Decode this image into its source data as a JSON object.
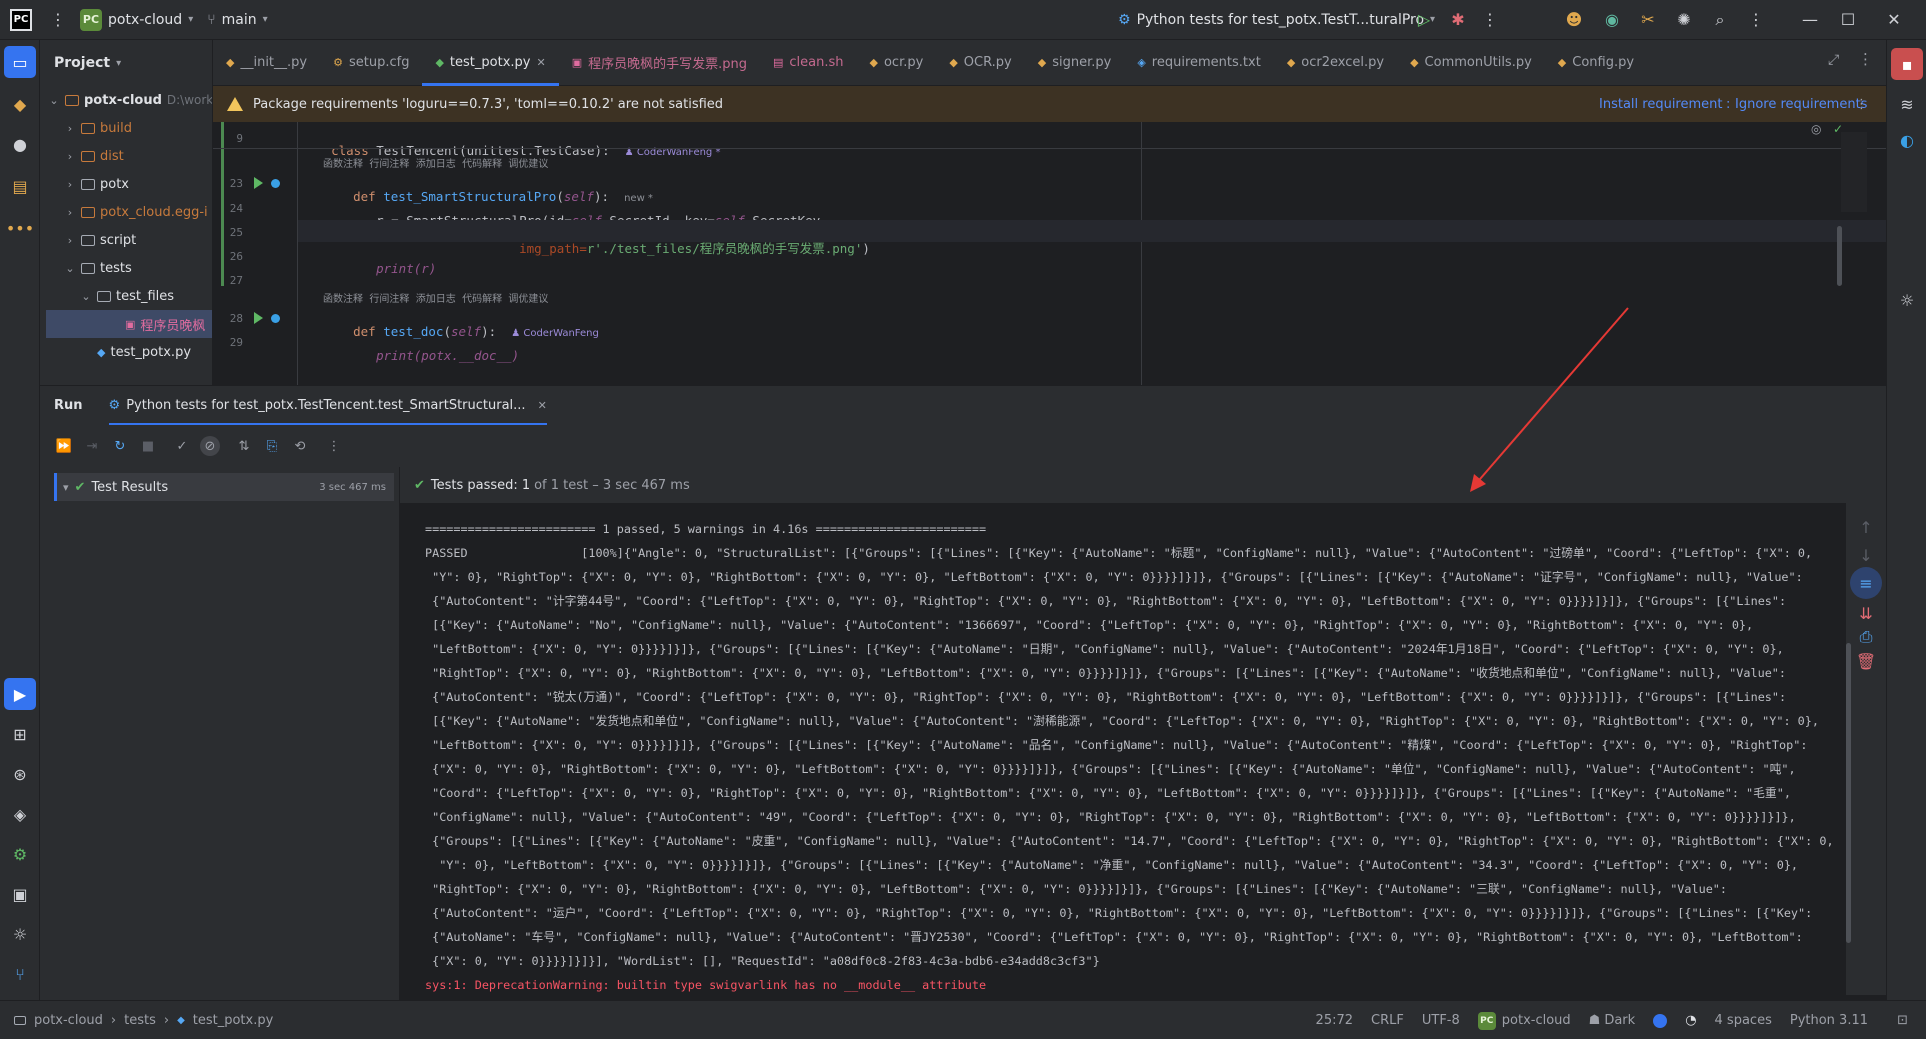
{
  "titlebar": {
    "project_name": "potx-cloud",
    "branch": "main",
    "run_config": "Python tests for test_potx.TestT...turalPro"
  },
  "project_panel": {
    "title": "Project",
    "items": [
      {
        "label": "potx-cloud",
        "suffix": "D:\\work",
        "indent": 0,
        "type": "root"
      },
      {
        "label": "build",
        "indent": 1,
        "type": "folder-orange"
      },
      {
        "label": "dist",
        "indent": 1,
        "type": "folder-orange"
      },
      {
        "label": "potx",
        "indent": 1,
        "type": "folder"
      },
      {
        "label": "potx_cloud.egg-i",
        "indent": 1,
        "type": "folder-orange"
      },
      {
        "label": "script",
        "indent": 1,
        "type": "folder"
      },
      {
        "label": "tests",
        "indent": 1,
        "type": "folder"
      },
      {
        "label": "test_files",
        "indent": 2,
        "type": "folder"
      },
      {
        "label": "程序员晚枫",
        "indent": 3,
        "type": "image-file"
      },
      {
        "label": "test_potx.py",
        "indent": 2,
        "type": "py-file"
      }
    ]
  },
  "tabs": [
    {
      "label": "__init__.py",
      "icon": "python-icon",
      "active": false
    },
    {
      "label": "setup.cfg",
      "icon": "config-icon",
      "active": false
    },
    {
      "label": "test_potx.py",
      "icon": "python-test-icon",
      "active": true
    },
    {
      "label": "程序员晚枫的手写发票.png",
      "icon": "image-icon",
      "active": false
    },
    {
      "label": "clean.sh",
      "icon": "shell-icon",
      "active": false
    },
    {
      "label": "ocr.py",
      "icon": "python-icon",
      "active": false
    },
    {
      "label": "OCR.py",
      "icon": "python-icon",
      "active": false
    },
    {
      "label": "signer.py",
      "icon": "python-icon",
      "active": false
    },
    {
      "label": "requirements.txt",
      "icon": "requirements-icon",
      "active": false
    },
    {
      "label": "ocr2excel.py",
      "icon": "python-icon",
      "active": false
    },
    {
      "label": "CommonUtils.py",
      "icon": "python-icon",
      "active": false
    },
    {
      "label": "Config.py",
      "icon": "python-icon",
      "active": false
    }
  ],
  "banner": {
    "message": "Package requirements 'loguru==0.7.3', 'toml==0.10.2' are not satisfied",
    "install_link": "Install requirement",
    "ignore_link": "Ignore requirements"
  },
  "editor": {
    "line_numbers": [
      "9",
      "23",
      "24",
      "25",
      "26",
      "27",
      "28",
      "29"
    ],
    "class_line": {
      "kw": "class",
      "name": "TestTencent",
      "base": "(unittest.TestCase):",
      "author": "CoderWanFeng *"
    },
    "hints": "函数注释  行间注释  添加日志  代码解释  调优建议",
    "def1": {
      "kw": "def",
      "name": "test_SmartStructuralPro",
      "self": "self",
      "tail": "):",
      "new_tag": "new *"
    },
    "line24_a": "r = SmartStructuralPro(id=",
    "line24_self1": "self",
    "line24_b": ".SecretId, key=",
    "line24_self2": "self",
    "line24_c": ".SecretKey,",
    "line25_a": "img_path=",
    "line25_str": "r'./test_files/程序员晚枫的手写发票.png'",
    "line25_b": ")",
    "line26": "print(r)",
    "def2": {
      "kw": "def",
      "name": "test_doc",
      "self": "self",
      "tail": "):",
      "author": "CoderWanFeng"
    },
    "line29": "print(potx.__doc__)"
  },
  "run_panel": {
    "title": "Run",
    "tab_label": "Python tests for test_potx.TestTencent.test_SmartStructural...",
    "results_label": "Test Results",
    "results_time": "3 sec 467 ms",
    "status_passed": "Tests passed:",
    "status_count": "1",
    "status_detail": "of 1 test – 3 sec 467 ms"
  },
  "console": {
    "lines": [
      "======================== 1 passed, 5 warnings in 4.16s ========================",
      "PASSED                [100%]{\"Angle\": 0, \"StructuralList\": [{\"Groups\": [{\"Lines\": [{\"Key\": {\"AutoName\": \"标题\", \"ConfigName\": null}, \"Value\": {\"AutoContent\": \"过磅单\", \"Coord\": {\"LeftTop\": {\"X\": 0,",
      " \"Y\": 0}, \"RightTop\": {\"X\": 0, \"Y\": 0}, \"RightBottom\": {\"X\": 0, \"Y\": 0}, \"LeftBottom\": {\"X\": 0, \"Y\": 0}}}}]}]}, {\"Groups\": [{\"Lines\": [{\"Key\": {\"AutoName\": \"证字号\", \"ConfigName\": null}, \"Value\":",
      " {\"AutoContent\": \"计字第44号\", \"Coord\": {\"LeftTop\": {\"X\": 0, \"Y\": 0}, \"RightTop\": {\"X\": 0, \"Y\": 0}, \"RightBottom\": {\"X\": 0, \"Y\": 0}, \"LeftBottom\": {\"X\": 0, \"Y\": 0}}}}]}]}, {\"Groups\": [{\"Lines\":",
      " [{\"Key\": {\"AutoName\": \"No\", \"ConfigName\": null}, \"Value\": {\"AutoContent\": \"1366697\", \"Coord\": {\"LeftTop\": {\"X\": 0, \"Y\": 0}, \"RightTop\": {\"X\": 0, \"Y\": 0}, \"RightBottom\": {\"X\": 0, \"Y\": 0},",
      " \"LeftBottom\": {\"X\": 0, \"Y\": 0}}}}]}]}, {\"Groups\": [{\"Lines\": [{\"Key\": {\"AutoName\": \"日期\", \"ConfigName\": null}, \"Value\": {\"AutoContent\": \"2024年1月18日\", \"Coord\": {\"LeftTop\": {\"X\": 0, \"Y\": 0},",
      " \"RightTop\": {\"X\": 0, \"Y\": 0}, \"RightBottom\": {\"X\": 0, \"Y\": 0}, \"LeftBottom\": {\"X\": 0, \"Y\": 0}}}}]}]}, {\"Groups\": [{\"Lines\": [{\"Key\": {\"AutoName\": \"收货地点和单位\", \"ConfigName\": null}, \"Value\":",
      " {\"AutoContent\": \"锐太(万通)\", \"Coord\": {\"LeftTop\": {\"X\": 0, \"Y\": 0}, \"RightTop\": {\"X\": 0, \"Y\": 0}, \"RightBottom\": {\"X\": 0, \"Y\": 0}, \"LeftBottom\": {\"X\": 0, \"Y\": 0}}}}]}]}, {\"Groups\": [{\"Lines\":",
      " [{\"Key\": {\"AutoName\": \"发货地点和单位\", \"ConfigName\": null}, \"Value\": {\"AutoContent\": \"澍稀能源\", \"Coord\": {\"LeftTop\": {\"X\": 0, \"Y\": 0}, \"RightTop\": {\"X\": 0, \"Y\": 0}, \"RightBottom\": {\"X\": 0, \"Y\": 0},",
      " \"LeftBottom\": {\"X\": 0, \"Y\": 0}}}}]}]}, {\"Groups\": [{\"Lines\": [{\"Key\": {\"AutoName\": \"品名\", \"ConfigName\": null}, \"Value\": {\"AutoContent\": \"精煤\", \"Coord\": {\"LeftTop\": {\"X\": 0, \"Y\": 0}, \"RightTop\":",
      " {\"X\": 0, \"Y\": 0}, \"RightBottom\": {\"X\": 0, \"Y\": 0}, \"LeftBottom\": {\"X\": 0, \"Y\": 0}}}}]}]}, {\"Groups\": [{\"Lines\": [{\"Key\": {\"AutoName\": \"单位\", \"ConfigName\": null}, \"Value\": {\"AutoContent\": \"吨\",",
      " \"Coord\": {\"LeftTop\": {\"X\": 0, \"Y\": 0}, \"RightTop\": {\"X\": 0, \"Y\": 0}, \"RightBottom\": {\"X\": 0, \"Y\": 0}, \"LeftBottom\": {\"X\": 0, \"Y\": 0}}}}]}]}, {\"Groups\": [{\"Lines\": [{\"Key\": {\"AutoName\": \"毛重\",",
      " \"ConfigName\": null}, \"Value\": {\"AutoContent\": \"49\", \"Coord\": {\"LeftTop\": {\"X\": 0, \"Y\": 0}, \"RightTop\": {\"X\": 0, \"Y\": 0}, \"RightBottom\": {\"X\": 0, \"Y\": 0}, \"LeftBottom\": {\"X\": 0, \"Y\": 0}}}}]}]},",
      " {\"Groups\": [{\"Lines\": [{\"Key\": {\"AutoName\": \"皮重\", \"ConfigName\": null}, \"Value\": {\"AutoContent\": \"14.7\", \"Coord\": {\"LeftTop\": {\"X\": 0, \"Y\": 0}, \"RightTop\": {\"X\": 0, \"Y\": 0}, \"RightBottom\": {\"X\": 0,",
      "  \"Y\": 0}, \"LeftBottom\": {\"X\": 0, \"Y\": 0}}}}]}]}, {\"Groups\": [{\"Lines\": [{\"Key\": {\"AutoName\": \"净重\", \"ConfigName\": null}, \"Value\": {\"AutoContent\": \"34.3\", \"Coord\": {\"LeftTop\": {\"X\": 0, \"Y\": 0},",
      " \"RightTop\": {\"X\": 0, \"Y\": 0}, \"RightBottom\": {\"X\": 0, \"Y\": 0}, \"LeftBottom\": {\"X\": 0, \"Y\": 0}}}}]}]}, {\"Groups\": [{\"Lines\": [{\"Key\": {\"AutoName\": \"三联\", \"ConfigName\": null}, \"Value\":",
      " {\"AutoContent\": \"运户\", \"Coord\": {\"LeftTop\": {\"X\": 0, \"Y\": 0}, \"RightTop\": {\"X\": 0, \"Y\": 0}, \"RightBottom\": {\"X\": 0, \"Y\": 0}, \"LeftBottom\": {\"X\": 0, \"Y\": 0}}}}]}]}, {\"Groups\": [{\"Lines\": [{\"Key\":",
      " {\"AutoName\": \"车号\", \"ConfigName\": null}, \"Value\": {\"AutoContent\": \"晋JY2530\", \"Coord\": {\"LeftTop\": {\"X\": 0, \"Y\": 0}, \"RightTop\": {\"X\": 0, \"Y\": 0}, \"RightBottom\": {\"X\": 0, \"Y\": 0}, \"LeftBottom\":",
      " {\"X\": 0, \"Y\": 0}}}}]}]}], \"WordList\": [], \"RequestId\": \"a08df0c8-2f83-4c3a-bdb6-e34add8c3cf3\"}"
    ],
    "error_line": "sys:1: DeprecationWarning: builtin type swigvarlink has no __module__ attribute"
  },
  "statusbar": {
    "breadcrumb": [
      "potx-cloud",
      "tests",
      "test_potx.py"
    ],
    "position": "25:72",
    "line_sep": "CRLF",
    "encoding": "UTF-8",
    "interpreter_badge": "PC",
    "interpreter_project": "potx-cloud",
    "theme": "Dark",
    "indent": "4 spaces",
    "python": "Python 3.11"
  },
  "colors": {
    "accent": "#3574f0",
    "passed": "#5fb865",
    "warning_bg": "#3d3223",
    "annotation_arrow": "#e53935"
  }
}
